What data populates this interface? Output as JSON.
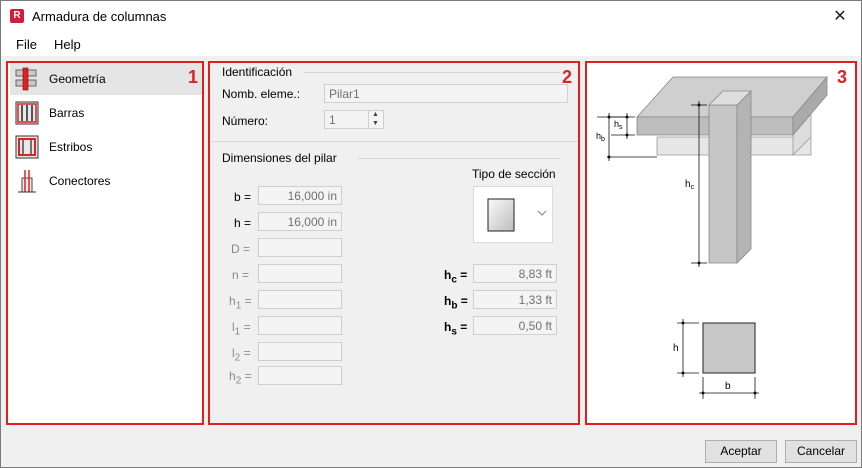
{
  "window": {
    "title": "Armadura de columnas",
    "app_icon": "R",
    "close_label": "✕"
  },
  "menu": {
    "file": "File",
    "help": "Help"
  },
  "nav": {
    "items": [
      {
        "label": "Geometría"
      },
      {
        "label": "Barras"
      },
      {
        "label": "Estribos"
      },
      {
        "label": "Conectores"
      }
    ]
  },
  "annotations": {
    "one": "1",
    "two": "2",
    "three": "3"
  },
  "identification": {
    "group_title": "Identificación",
    "name_label": "Nomb. eleme.:",
    "name_value": "Pilar1",
    "number_label": "Número:",
    "number_value": "1"
  },
  "dimensions": {
    "group_title": "Dimensiones del pilar",
    "b": {
      "label": "b =",
      "value": "16,000 in"
    },
    "h": {
      "label": "h =",
      "value": "16,000 in"
    },
    "D": {
      "label": "D =",
      "value": ""
    },
    "n": {
      "label": "n =",
      "value": ""
    },
    "h1": {
      "label": "h",
      "sub": "1",
      "suffix": " =",
      "value": ""
    },
    "l1": {
      "label": "l",
      "sub": "1",
      "suffix": " =",
      "value": ""
    },
    "l2": {
      "label": "l",
      "sub": "2",
      "suffix": " =",
      "value": ""
    },
    "h2": {
      "label": "h",
      "sub": "2",
      "suffix": " =",
      "value": ""
    },
    "section_type_label": "Tipo de sección",
    "hc": {
      "label": "h",
      "sub": "c",
      "suffix": " =",
      "value": "8,83 ft"
    },
    "hb": {
      "label": "h",
      "sub": "b",
      "suffix": " =",
      "value": "1,33 ft"
    },
    "hs": {
      "label": "h",
      "sub": "s",
      "suffix": " =",
      "value": "0,50 ft"
    }
  },
  "diagram": {
    "hs_label": "h",
    "hs_sub": "s",
    "hb_label": "h",
    "hb_sub": "b",
    "hc_label": "h",
    "hc_sub": "c",
    "h_label": "h",
    "b_label": "b"
  },
  "buttons": {
    "accept": "Aceptar",
    "cancel": "Cancelar"
  }
}
